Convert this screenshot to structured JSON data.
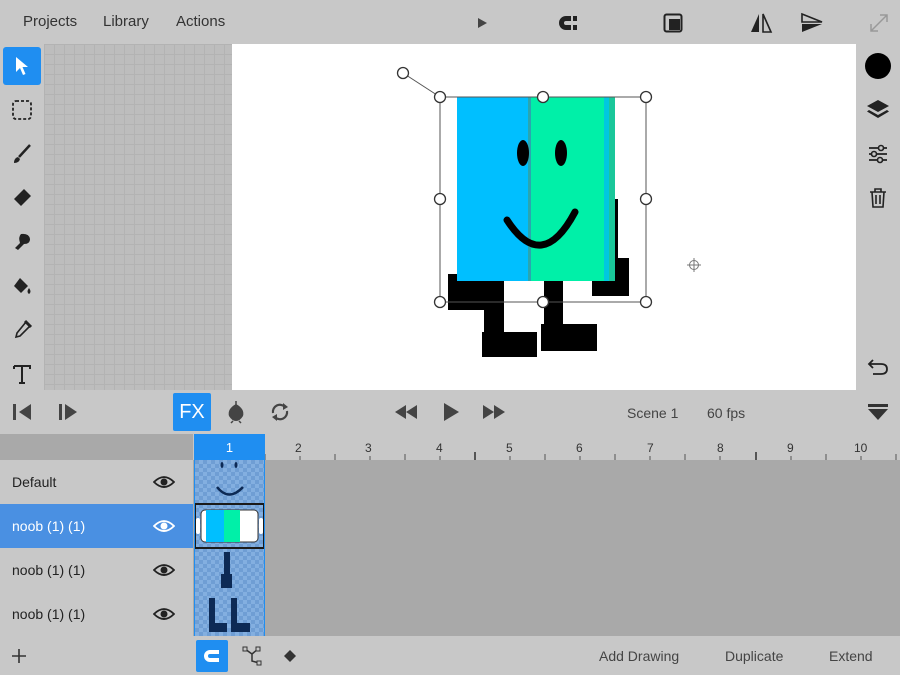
{
  "menu": {
    "projects": "Projects",
    "library": "Library",
    "actions": "Actions"
  },
  "colors": {
    "accent": "#1f8ef1",
    "selected_layer": "#4a90e2",
    "character_blue": "#00bfff",
    "character_green": "#00f0a8",
    "current_color": "#000000"
  },
  "toolbar_icons": [
    "play-icon",
    "magnet-icon",
    "crop-icon",
    "flip-horizontal-icon",
    "flip-vertical-icon",
    "expand-icon"
  ],
  "left_tools": [
    "select-tool",
    "marquee-tool",
    "brush-tool",
    "eraser-tool",
    "smudge-tool",
    "fill-tool",
    "eyedropper-tool",
    "text-tool"
  ],
  "right_tools": [
    "color-swatch",
    "layers-icon",
    "adjust-icon",
    "trash-icon",
    "undo-icon"
  ],
  "playbar": {
    "fx_label": "FX",
    "scene": "Scene 1",
    "fps": "60 fps"
  },
  "timeline": {
    "current_frame": "1",
    "frame_numbers": [
      "2",
      "3",
      "4",
      "5",
      "6",
      "7",
      "8",
      "9",
      "10"
    ],
    "layers": [
      {
        "name": "Default",
        "selected": false
      },
      {
        "name": "noob (1) (1)",
        "selected": true
      },
      {
        "name": "noob (1) (1)",
        "selected": false
      },
      {
        "name": "noob (1) (1)",
        "selected": false
      }
    ]
  },
  "bottombar": {
    "add_drawing": "Add Drawing",
    "duplicate": "Duplicate",
    "extend": "Extend"
  }
}
